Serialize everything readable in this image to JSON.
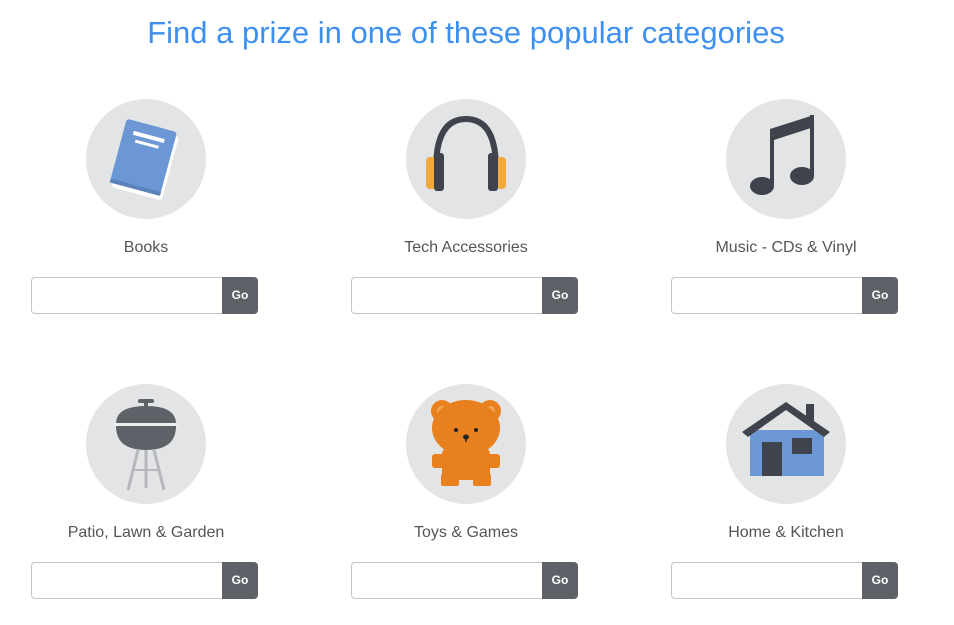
{
  "page": {
    "title": "Find a prize in one of these popular categories"
  },
  "categories": [
    {
      "label": "Books",
      "icon": "book-icon",
      "input_value": "",
      "go_label": "Go"
    },
    {
      "label": "Tech Accessories",
      "icon": "headphones-icon",
      "input_value": "",
      "go_label": "Go"
    },
    {
      "label": "Music - CDs & Vinyl",
      "icon": "music-note-icon",
      "input_value": "",
      "go_label": "Go"
    },
    {
      "label": "Patio, Lawn & Garden",
      "icon": "grill-icon",
      "input_value": "",
      "go_label": "Go"
    },
    {
      "label": "Toys & Games",
      "icon": "teddy-bear-icon",
      "input_value": "",
      "go_label": "Go"
    },
    {
      "label": "Home & Kitchen",
      "icon": "house-icon",
      "input_value": "",
      "go_label": "Go"
    }
  ],
  "colors": {
    "title": "#3d8ff0",
    "circle_bg": "#e3e4e6",
    "button_bg": "#5d6168",
    "book_blue": "#6b97d4",
    "headphone_orange": "#f2a83a",
    "headphone_dark": "#3f444c",
    "bear_orange": "#e8801e",
    "house_blue": "#6b97d4",
    "house_roof": "#3f444c",
    "grill_gray": "#5d6168"
  }
}
